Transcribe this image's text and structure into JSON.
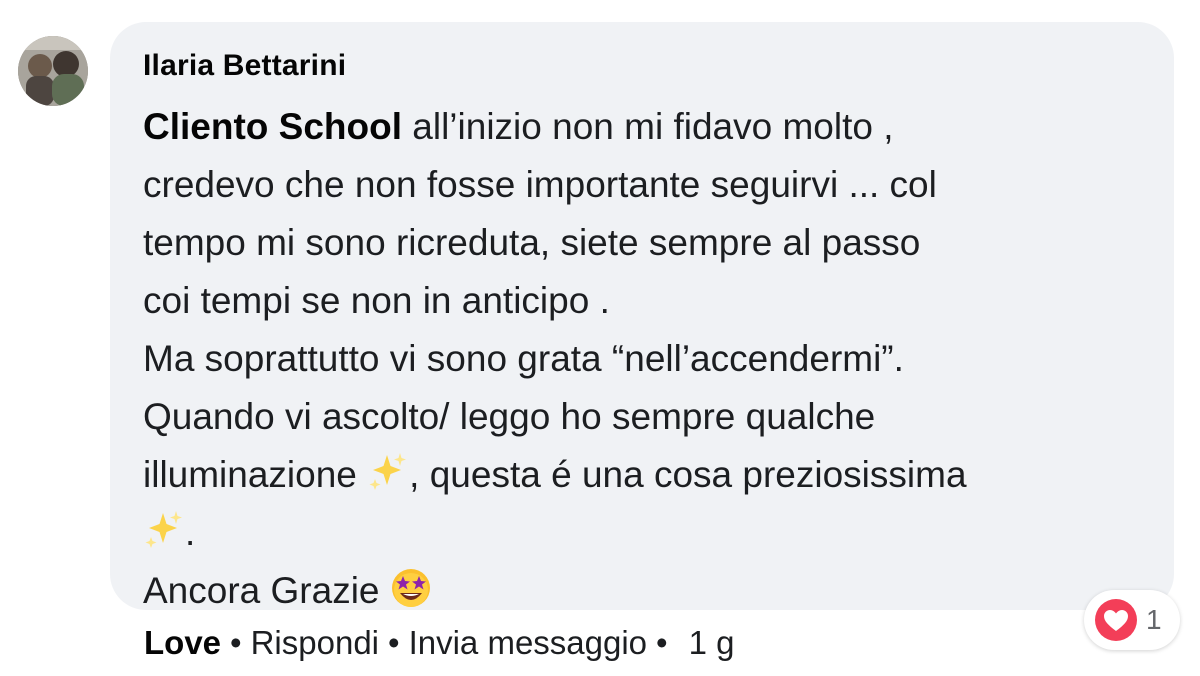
{
  "comment": {
    "author": "Ilaria Bettarini",
    "mention": "Cliento School",
    "lines": [
      " all’inizio non mi fidavo molto ,",
      "credevo che non fosse importante seguirvi ... col",
      "tempo mi sono ricreduta, siete sempre al passo",
      "coi tempi se non in anticipo .",
      "Ma soprattutto vi sono grata “nell’accendermi”.",
      "Quando vi ascolto/ leggo ho sempre qualche",
      "illuminazione",
      ", questa é una cosa preziosissima",
      ".",
      "Ancora Grazie"
    ],
    "emojis": {
      "sparkles": "sparkles-icon",
      "star_struck": "star-struck-emoji-icon"
    }
  },
  "reaction": {
    "icon": "love-heart-icon",
    "color": "#f33e58",
    "count": "1"
  },
  "actions": {
    "love": "Love",
    "reply": "Rispondi",
    "message": "Invia messaggio",
    "separator": "•",
    "time": "1 g"
  }
}
